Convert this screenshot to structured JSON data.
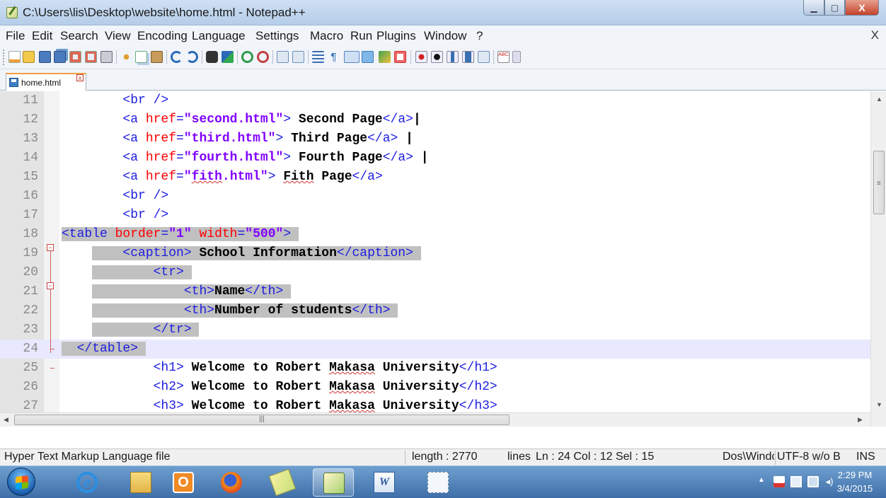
{
  "window": {
    "title": "C:\\Users\\lis\\Desktop\\website\\home.html - Notepad++",
    "minimize_glyph": "▁",
    "maximize_glyph": "▢",
    "close_glyph": "X"
  },
  "menu": {
    "items": [
      "File",
      "Edit",
      "Search",
      "View",
      "Encoding",
      "Language",
      "Settings",
      "Macro",
      "Run",
      "Plugins",
      "Window",
      "?"
    ],
    "close_glyph": "X"
  },
  "toolbar": {
    "icons": [
      "new-file-icon",
      "open-file-icon",
      "save-icon",
      "save-all-icon",
      "close-icon",
      "close-all-icon",
      "print-icon",
      "cut-icon",
      "copy-icon",
      "paste-icon",
      "undo-icon",
      "redo-icon",
      "find-icon",
      "replace-icon",
      "zoom-in-icon",
      "zoom-out-icon",
      "sync-vertical-icon",
      "sync-horizontal-icon",
      "word-wrap-icon",
      "show-all-characters-icon",
      "indent-guide-icon",
      "user-defined-language-icon",
      "document-map-icon",
      "function-list-icon",
      "record-macro-icon",
      "stop-recording-icon",
      "play-macro-icon",
      "run-macro-multiple-icon",
      "save-macro-icon",
      "spell-check-icon",
      "spell-check-options-icon"
    ]
  },
  "tab": {
    "label": "home.html",
    "close_glyph": "x"
  },
  "editor": {
    "lines": [
      {
        "num": "11",
        "indent": "        ",
        "segments": [
          {
            "t": "tag",
            "s": "<br />"
          }
        ]
      },
      {
        "num": "12",
        "indent": "        ",
        "segments": [
          {
            "t": "tag",
            "s": "<a "
          },
          {
            "t": "attr",
            "s": "href"
          },
          {
            "t": "tag",
            "s": "="
          },
          {
            "t": "val",
            "s": "\"second.html\""
          },
          {
            "t": "tag",
            "s": "> "
          },
          {
            "t": "text",
            "s": "Second Page"
          },
          {
            "t": "tag",
            "s": "</a>"
          },
          {
            "t": "text",
            "s": "|"
          }
        ]
      },
      {
        "num": "13",
        "indent": "        ",
        "segments": [
          {
            "t": "tag",
            "s": "<a "
          },
          {
            "t": "attr",
            "s": "href"
          },
          {
            "t": "tag",
            "s": "="
          },
          {
            "t": "val",
            "s": "\"third.html\""
          },
          {
            "t": "tag",
            "s": "> "
          },
          {
            "t": "text",
            "s": "Third Page"
          },
          {
            "t": "tag",
            "s": "</a>"
          },
          {
            "t": "text",
            "s": " |"
          }
        ]
      },
      {
        "num": "14",
        "indent": "        ",
        "segments": [
          {
            "t": "tag",
            "s": "<a "
          },
          {
            "t": "attr",
            "s": "href"
          },
          {
            "t": "tag",
            "s": "="
          },
          {
            "t": "val",
            "s": "\"fourth.html\""
          },
          {
            "t": "tag",
            "s": "> "
          },
          {
            "t": "text",
            "s": "Fourth Page"
          },
          {
            "t": "tag",
            "s": "</a>"
          },
          {
            "t": "text",
            "s": " |"
          }
        ]
      },
      {
        "num": "15",
        "indent": "        ",
        "segments": [
          {
            "t": "tag",
            "s": "<a "
          },
          {
            "t": "attr",
            "s": "href"
          },
          {
            "t": "tag",
            "s": "="
          },
          {
            "t": "val",
            "s": "\""
          },
          {
            "t": "val-spell",
            "s": "fith"
          },
          {
            "t": "val",
            "s": ".html\""
          },
          {
            "t": "tag",
            "s": "> "
          },
          {
            "t": "text-spell",
            "s": "Fith"
          },
          {
            "t": "text",
            "s": " Page"
          },
          {
            "t": "tag",
            "s": "</a>"
          }
        ]
      },
      {
        "num": "16",
        "indent": "        ",
        "segments": [
          {
            "t": "tag",
            "s": "<br />"
          }
        ]
      },
      {
        "num": "17",
        "indent": "        ",
        "segments": [
          {
            "t": "tag",
            "s": "<br />"
          }
        ]
      },
      {
        "num": "18",
        "indent": "",
        "segments": [
          {
            "t": "tag",
            "s": "<table "
          },
          {
            "t": "attr",
            "s": "border"
          },
          {
            "t": "tag",
            "s": "="
          },
          {
            "t": "val",
            "s": "\"1\""
          },
          {
            "t": "tag",
            "s": " "
          },
          {
            "t": "attr",
            "s": "width"
          },
          {
            "t": "tag",
            "s": "="
          },
          {
            "t": "val",
            "s": "\"500\""
          },
          {
            "t": "tag",
            "s": "> "
          }
        ]
      },
      {
        "num": "19",
        "indent": "    ",
        "segments": [
          {
            "t": "tag",
            "s": "    <caption> "
          },
          {
            "t": "text",
            "s": "School Information"
          },
          {
            "t": "tag",
            "s": "</caption> "
          }
        ]
      },
      {
        "num": "20",
        "indent": "    ",
        "segments": [
          {
            "t": "tag",
            "s": "        <tr> "
          }
        ]
      },
      {
        "num": "21",
        "indent": "    ",
        "segments": [
          {
            "t": "tag",
            "s": "            <th>"
          },
          {
            "t": "text",
            "s": "Name"
          },
          {
            "t": "tag",
            "s": "</th> "
          }
        ]
      },
      {
        "num": "22",
        "indent": "    ",
        "segments": [
          {
            "t": "tag",
            "s": "            <th>"
          },
          {
            "t": "text",
            "s": "Number of students"
          },
          {
            "t": "tag",
            "s": "</th> "
          }
        ]
      },
      {
        "num": "23",
        "indent": "    ",
        "segments": [
          {
            "t": "tag",
            "s": "        </tr> "
          }
        ]
      },
      {
        "num": "24",
        "indent": "",
        "segments": [
          {
            "t": "tag",
            "s": "  </table> "
          }
        ]
      },
      {
        "num": "25",
        "indent": "            ",
        "segments": [
          {
            "t": "tag",
            "s": "<h1> "
          },
          {
            "t": "text",
            "s": "Welcome to Robert "
          },
          {
            "t": "text-spell",
            "s": "Makasa"
          },
          {
            "t": "text",
            "s": " University"
          },
          {
            "t": "tag",
            "s": "</h1>"
          }
        ]
      },
      {
        "num": "26",
        "indent": "            ",
        "segments": [
          {
            "t": "tag",
            "s": "<h2> "
          },
          {
            "t": "text",
            "s": "Welcome to Robert "
          },
          {
            "t": "text-spell",
            "s": "Makasa"
          },
          {
            "t": "text",
            "s": " University"
          },
          {
            "t": "tag",
            "s": "</h2>"
          }
        ]
      },
      {
        "num": "27",
        "indent": "            ",
        "segments": [
          {
            "t": "tag",
            "s": "<h3> "
          },
          {
            "t": "text",
            "s": "Welcome to Robert "
          },
          {
            "t": "text-spell",
            "s": "Makasa"
          },
          {
            "t": "text",
            "s": " University"
          },
          {
            "t": "tag",
            "s": "</h3>"
          }
        ]
      }
    ],
    "selected_lines": [
      "18",
      "19",
      "20",
      "21",
      "22",
      "23",
      "24"
    ],
    "current_line": "24",
    "colors": {
      "tag": "#1d1de0",
      "attr": "#ff0000",
      "value": "#8000ff",
      "selection": "#c0c0c0",
      "current_line": "#e8e8ff"
    }
  },
  "status": {
    "file_type": "Hyper Text Markup Language file",
    "length": "length : 2770",
    "lines": "lines",
    "position": "Ln : 24    Col : 12    Sel : 15",
    "eol": "Dos\\Windc",
    "encoding": "UTF-8 w/o B",
    "insert_mode": "INS"
  },
  "taskbar": {
    "apps": [
      "internet-explorer-icon",
      "file-explorer-icon",
      "media-player-icon",
      "firefox-icon",
      "sticky-notes-icon",
      "notepad-plus-plus-icon",
      "word-icon",
      "snipping-tool-icon"
    ],
    "active_app": "notepad-plus-plus-icon",
    "time": "2:29 PM",
    "date": "3/4/2015"
  }
}
